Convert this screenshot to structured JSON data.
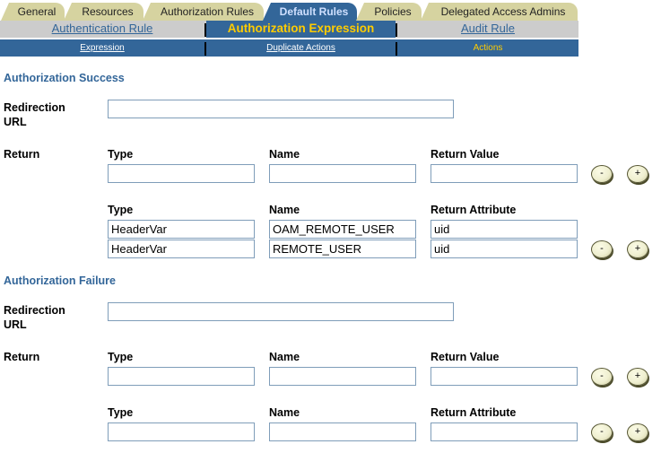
{
  "tabs": [
    {
      "label": "General",
      "active": false
    },
    {
      "label": "Resources",
      "active": false
    },
    {
      "label": "Authorization Rules",
      "active": false
    },
    {
      "label": "Default Rules",
      "active": true
    },
    {
      "label": "Policies",
      "active": false
    },
    {
      "label": "Delegated Access Admins",
      "active": false
    }
  ],
  "subtabs": [
    {
      "label": "Authentication Rule",
      "active": false
    },
    {
      "label": "Authorization Expression",
      "active": true
    },
    {
      "label": "Audit Rule",
      "active": false
    }
  ],
  "subsubtabs": [
    {
      "label": "Expression",
      "active": false
    },
    {
      "label": "Duplicate Actions",
      "active": false
    },
    {
      "label": "Actions",
      "active": true
    }
  ],
  "success": {
    "title": "Authorization Success",
    "redirection_label_1": "Redirection",
    "redirection_label_2": "URL",
    "redirection_value": "",
    "return_label": "Return",
    "value_headers": {
      "type": "Type",
      "name": "Name",
      "value": "Return Value"
    },
    "value_row": {
      "type": "",
      "name": "",
      "value": ""
    },
    "attr_headers": {
      "type": "Type",
      "name": "Name",
      "attr": "Return Attribute"
    },
    "attr_rows": [
      {
        "type": "HeaderVar",
        "name": "OAM_REMOTE_USER",
        "attr": "uid"
      },
      {
        "type": "HeaderVar",
        "name": "REMOTE_USER",
        "attr": "uid"
      }
    ]
  },
  "failure": {
    "title": "Authorization Failure",
    "redirection_label_1": "Redirection",
    "redirection_label_2": "URL",
    "redirection_value": "",
    "return_label": "Return",
    "value_headers": {
      "type": "Type",
      "name": "Name",
      "value": "Return Value"
    },
    "value_row": {
      "type": "",
      "name": "",
      "value": ""
    },
    "attr_headers": {
      "type": "Type",
      "name": "Name",
      "attr": "Return Attribute"
    },
    "attr_row": {
      "type": "",
      "name": "",
      "attr": ""
    }
  },
  "buttons": {
    "remove": "-",
    "add": "+"
  }
}
